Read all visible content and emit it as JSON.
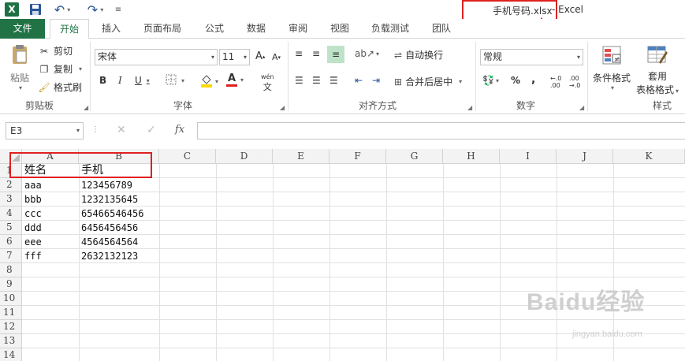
{
  "title_bar": {
    "document_name": "手机号码.xlsx",
    "separator": " - ",
    "app_name": "Excel",
    "icons": [
      "excel-logo-icon",
      "save-icon",
      "undo-icon",
      "redo-icon",
      "customize-qat-icon"
    ]
  },
  "tabs": [
    {
      "label": "文件"
    },
    {
      "label": "开始"
    },
    {
      "label": "插入"
    },
    {
      "label": "页面布局"
    },
    {
      "label": "公式"
    },
    {
      "label": "数据"
    },
    {
      "label": "审阅"
    },
    {
      "label": "视图"
    },
    {
      "label": "负载测试"
    },
    {
      "label": "团队"
    }
  ],
  "ribbon": {
    "clipboard": {
      "group_label": "剪贴板",
      "paste_label": "粘贴",
      "cut_label": "剪切",
      "copy_label": "复制",
      "format_painter_label": "格式刷"
    },
    "font": {
      "group_label": "字体",
      "font_name": "宋体",
      "font_size": "11",
      "bold": "B",
      "italic": "I",
      "underline": "U",
      "phonetic_label": "wén"
    },
    "alignment": {
      "group_label": "对齐方式",
      "wrap_text_label": "自动换行",
      "merge_center_label": "合并后居中"
    },
    "number": {
      "group_label": "数字",
      "format": "常规",
      "percent": "%",
      "comma": ","
    },
    "styles": {
      "group_label": "样式",
      "conditional_format_label": "条件格式",
      "format_table_label_1": "套用",
      "format_table_label_2": "表格格式"
    }
  },
  "formula_bar": {
    "name_box": "E3",
    "fx_label": "fx",
    "formula": ""
  },
  "sheet": {
    "columns": [
      "A",
      "B",
      "C",
      "D",
      "E",
      "F",
      "G",
      "H",
      "I",
      "J",
      "K"
    ],
    "rows": [
      "1",
      "2",
      "3",
      "4",
      "5",
      "6",
      "7",
      "8",
      "9",
      "10",
      "11",
      "12",
      "13",
      "14"
    ],
    "header_row": {
      "a": "姓名",
      "b": "手机"
    },
    "data": [
      {
        "a": "aaa",
        "b": "123456789"
      },
      {
        "a": "bbb",
        "b": "1232135645"
      },
      {
        "a": "ccc",
        "b": "65466546456"
      },
      {
        "a": "ddd",
        "b": "6456456456"
      },
      {
        "a": "eee",
        "b": "4564564564"
      },
      {
        "a": "fff",
        "b": "2632132123"
      }
    ]
  },
  "watermark": {
    "main": "Baidu经验",
    "sub": "jingyan.baidu.com"
  },
  "colors": {
    "accent": "#217346",
    "annotation": "#e02020"
  }
}
